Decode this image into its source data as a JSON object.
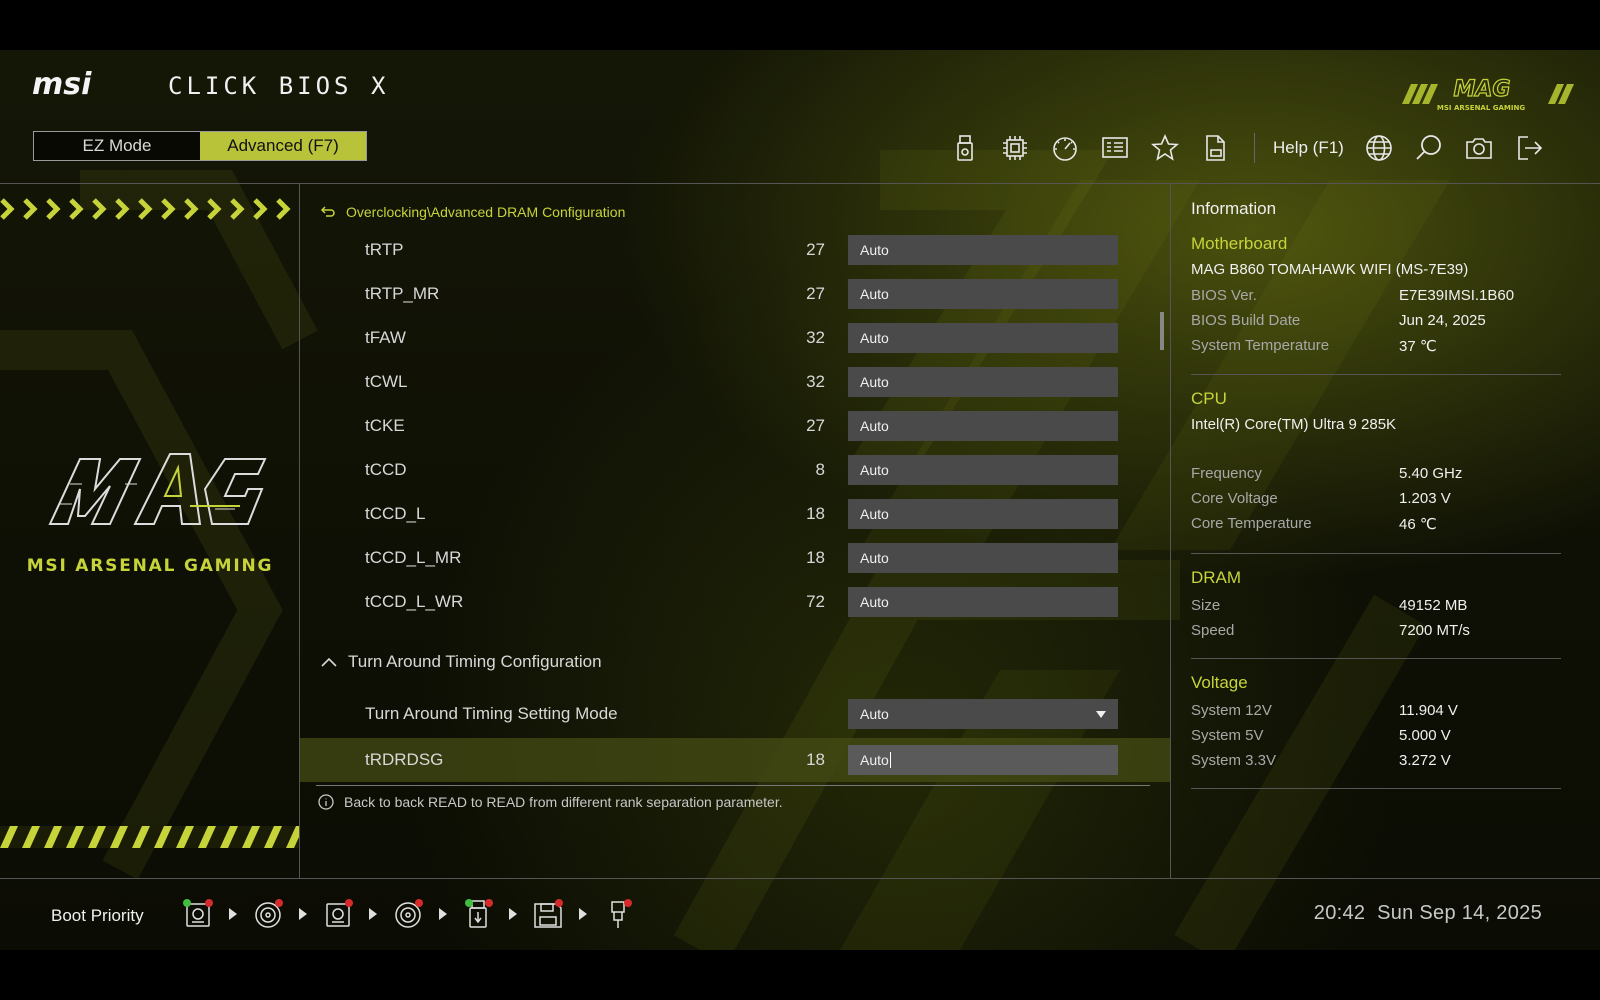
{
  "header": {
    "brand": "msi",
    "title": "CLICK BIOS X",
    "mag_logo": "MAG",
    "mag_subtitle": "MSI ARSENAL GAMING",
    "modes": {
      "ez_label": "EZ Mode",
      "advanced_label": "Advanced (F7)",
      "active": "advanced"
    },
    "toolbar_icons": [
      "usb-flash-icon",
      "cpu-chip-icon",
      "speedometer-icon",
      "hardware-monitor-icon",
      "favorites-star-icon",
      "log-file-icon"
    ],
    "help_label": "Help (F1)",
    "right_icons": [
      "language-globe-icon",
      "search-icon",
      "screenshot-camera-icon",
      "exit-icon"
    ]
  },
  "left_panel": {
    "brand_text": "MSI ARSENAL GAMING"
  },
  "main": {
    "breadcrumb": "Overclocking\\Advanced DRAM Configuration",
    "rows": [
      {
        "label": "tRTP",
        "current": "27",
        "value": "Auto"
      },
      {
        "label": "tRTP_MR",
        "current": "27",
        "value": "Auto"
      },
      {
        "label": "tFAW",
        "current": "32",
        "value": "Auto"
      },
      {
        "label": "tCWL",
        "current": "32",
        "value": "Auto"
      },
      {
        "label": "tCKE",
        "current": "27",
        "value": "Auto"
      },
      {
        "label": "tCCD",
        "current": "8",
        "value": "Auto"
      },
      {
        "label": "tCCD_L",
        "current": "18",
        "value": "Auto"
      },
      {
        "label": "tCCD_L_MR",
        "current": "18",
        "value": "Auto"
      },
      {
        "label": "tCCD_L_WR",
        "current": "72",
        "value": "Auto"
      }
    ],
    "section": {
      "label": "Turn Around Timing Configuration",
      "expanded": true
    },
    "mode_row": {
      "label": "Turn Around Timing Setting Mode",
      "value": "Auto"
    },
    "selected_row": {
      "label": "tRDRDSG",
      "current": "18",
      "value": "Auto"
    },
    "help_text": "Back to back READ to READ from different rank separation parameter."
  },
  "info": {
    "title": "Information",
    "motherboard": {
      "heading": "Motherboard",
      "model": "MAG B860 TOMAHAWK WIFI (MS-7E39)",
      "bios_ver_label": "BIOS Ver.",
      "bios_ver": "E7E39IMSI.1B60",
      "build_date_label": "BIOS Build Date",
      "build_date": "Jun 24, 2025",
      "sys_temp_label": "System Temperature",
      "sys_temp": "37 ℃"
    },
    "cpu": {
      "heading": "CPU",
      "model": "Intel(R) Core(TM) Ultra 9 285K",
      "freq_label": "Frequency",
      "freq": "5.40 GHz",
      "vcore_label": "Core Voltage",
      "vcore": "1.203 V",
      "temp_label": "Core Temperature",
      "temp": "46 ℃"
    },
    "dram": {
      "heading": "DRAM",
      "size_label": "Size",
      "size": "49152 MB",
      "speed_label": "Speed",
      "speed": "7200 MT/s"
    },
    "voltage": {
      "heading": "Voltage",
      "v12_label": "System 12V",
      "v12": "11.904 V",
      "v5_label": "System 5V",
      "v5": "5.000 V",
      "v33_label": "System 3.3V",
      "v33": "3.272 V"
    }
  },
  "footer": {
    "boot_label": "Boot Priority",
    "boot_devices": [
      "hdd-icon",
      "optical-disc-icon",
      "hdd-icon",
      "optical-disc-icon",
      "usb-stick-icon",
      "floppy-icon",
      "usb-icon"
    ],
    "time": "20:42",
    "date": "Sun Sep 14, 2025"
  },
  "colors": {
    "accent": "#c6d43a",
    "mode_active_bg": "#b8c33a",
    "field_bg": "#4a4a4a",
    "selected_row_bg": "#464c14",
    "badge_red": "#d42a2a",
    "badge_green": "#3fbf3f"
  }
}
